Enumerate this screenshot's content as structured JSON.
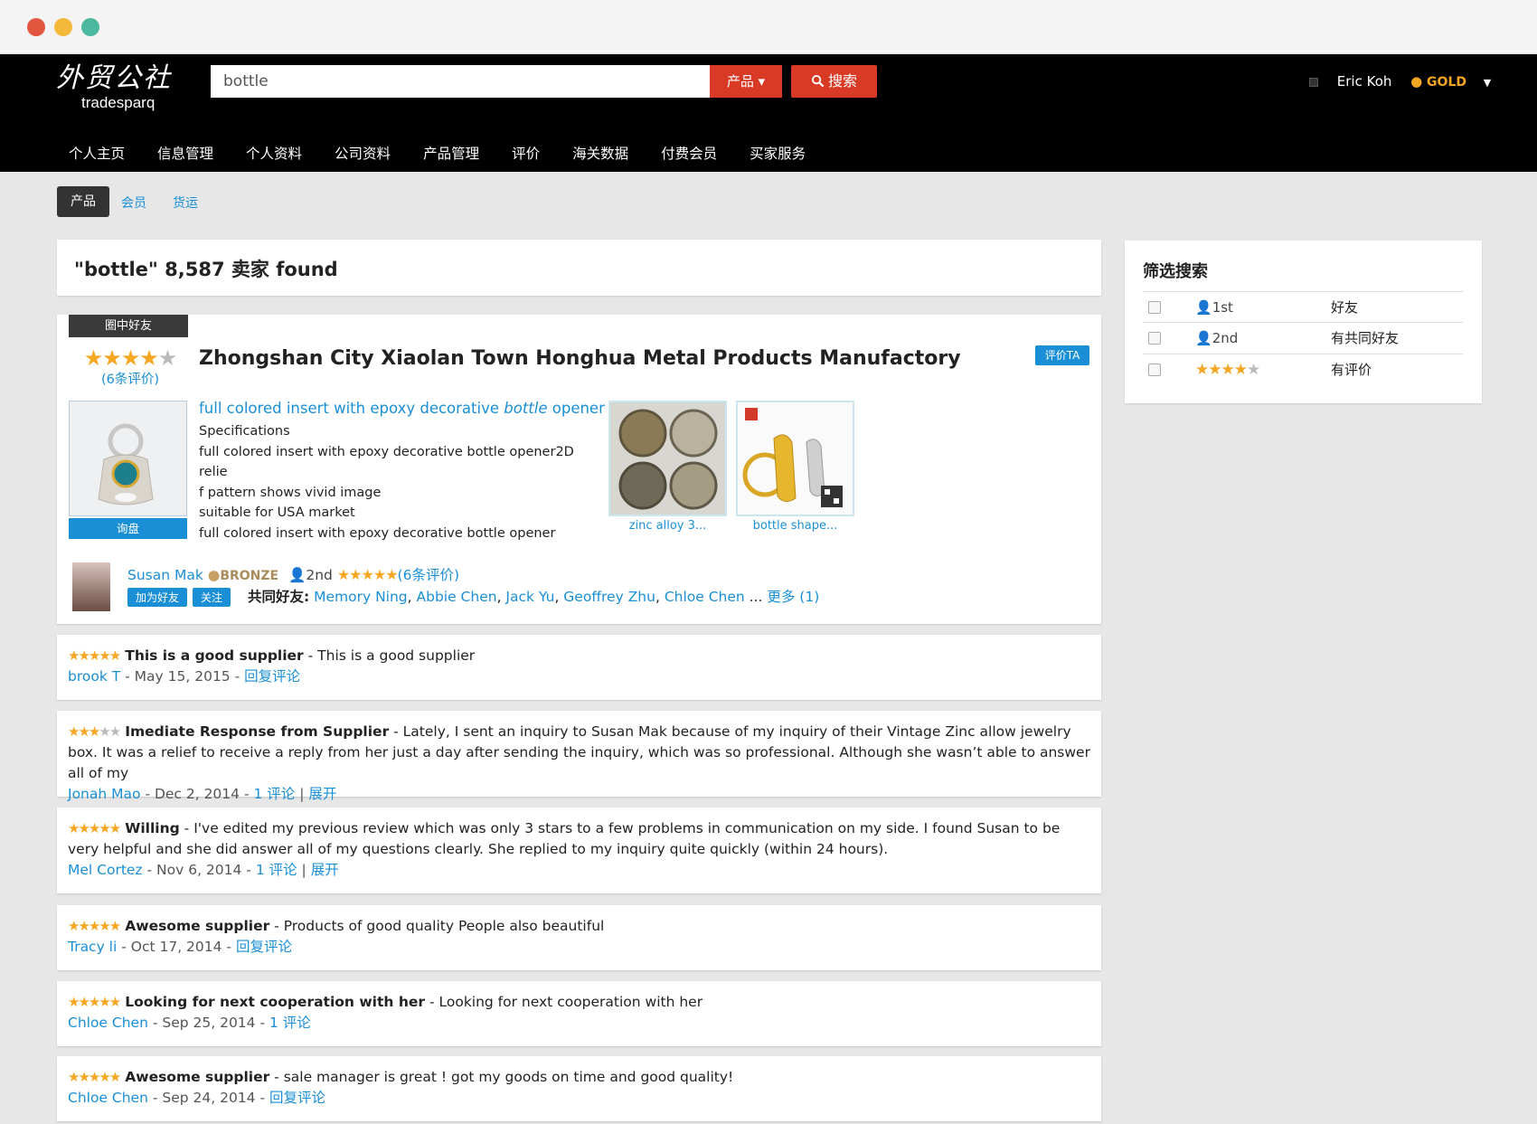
{
  "header": {
    "logo_cn": "外贸公社",
    "logo_en": "tradesparq",
    "search_value": "bottle",
    "search_type": "产品",
    "search_button": "搜索",
    "user_name": "Eric Koh",
    "user_level": "GOLD",
    "nav": [
      "个人主页",
      "信息管理",
      "个人资料",
      "公司资料",
      "产品管理",
      "评价",
      "海关数据",
      "付费会员",
      "买家服务"
    ]
  },
  "tabs": {
    "products": "产品",
    "members": "会员",
    "shipping": "货运"
  },
  "result": {
    "title": "\"bottle\" 8,587 卖家 found"
  },
  "supplier": {
    "tag": "圈中好友",
    "name": "Zhongshan City Xiaolan Town Honghua Metal Products Manufactory",
    "review_count": "(6条评价)",
    "rate_button": "评价TA",
    "product_title_pre": "full colored insert with epoxy decorative ",
    "product_title_em": "bottle",
    "product_title_post": " opener",
    "desc": [
      "Specifications",
      "full colored insert with epoxy decorative bottle opener2D relie",
      "f pattern shows vivid image",
      "suitable for USA market",
      "full colored insert with epoxy decorative  bottle opener"
    ],
    "inquiry_button": "询盘",
    "thumbs": [
      "zinc alloy 3...",
      "bottle shape..."
    ],
    "seller": {
      "name": "Susan Mak",
      "level": "BRONZE",
      "degree": "2nd",
      "reviews": "(6条评价)",
      "add_friend": "加为好友",
      "follow": "关注",
      "mutual_label": "共同好友:",
      "mutual": [
        "Memory Ning",
        "Abbie Chen",
        "Jack Yu",
        "Geoffrey Zhu",
        "Chloe Chen"
      ],
      "more": "更多 (1)"
    }
  },
  "reviews": [
    {
      "stars": 5,
      "title": "This is a good supplier",
      "body": "This is a good supplier",
      "author": "brook T",
      "date": "May 15, 2015",
      "action1": "回复评论",
      "action2": ""
    },
    {
      "stars": 3,
      "title": "Imediate Response from Supplier",
      "body": "Lately, I sent an inquiry to Susan Mak because of my inquiry of their Vintage Zinc allow jewelry box. It was a relief to receive a reply from her just a day after sending the inquiry, which was so professional. Although she wasn’t able to answer all of my",
      "author": "Jonah Mao",
      "date": "Dec 2, 2014",
      "action1": "1 评论",
      "action2": "展开"
    },
    {
      "stars": 5,
      "title": "Willing",
      "body": "I've edited my previous review which was only 3 stars to a few problems in communication on my side. I found Susan to be very helpful and she did answer all of my questions clearly. She replied to my inquiry quite quickly (within 24 hours).",
      "author": "Mel Cortez",
      "date": "Nov 6, 2014",
      "action1": "1 评论",
      "action2": "展开"
    },
    {
      "stars": 5,
      "title": "Awesome supplier",
      "body": "Products of good quality People also beautiful",
      "author": "Tracy li",
      "date": "Oct 17, 2014",
      "action1": "回复评论",
      "action2": ""
    },
    {
      "stars": 5,
      "title": "Looking for next cooperation with her",
      "body": "Looking for next cooperation with her",
      "author": "Chloe Chen",
      "date": "Sep 25, 2014",
      "action1": "1 评论",
      "action2": ""
    },
    {
      "stars": 5,
      "title": "Awesome supplier",
      "body": "sale manager is great ! got my goods on time and good quality!",
      "author": "Chloe Chen",
      "date": "Sep 24, 2014",
      "action1": "回复评论",
      "action2": ""
    }
  ],
  "filter": {
    "title": "筛选搜索",
    "rows": [
      {
        "value": "1st",
        "label": "好友"
      },
      {
        "value": "2nd",
        "label": "有共同好友"
      },
      {
        "value": "",
        "label": "有评价"
      }
    ]
  }
}
